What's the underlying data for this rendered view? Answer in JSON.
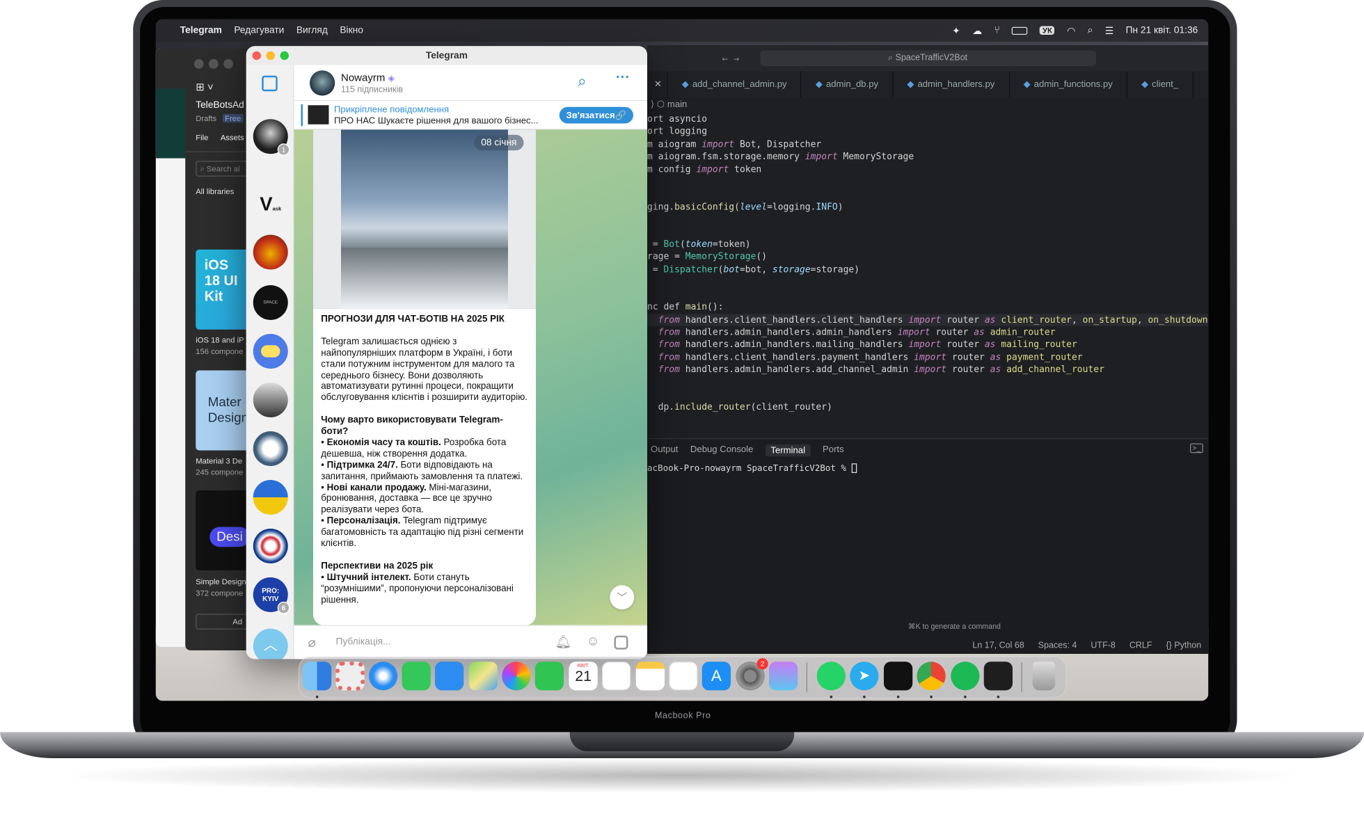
{
  "laptop": {
    "label": "Macbook Pro"
  },
  "menubar": {
    "app": "Telegram",
    "items": [
      "Редагувати",
      "Вигляд",
      "Вікно"
    ],
    "input_source": "УК",
    "datetime": "Пн 21 квіт.  01:36"
  },
  "figma": {
    "project": "TeleBotsAd",
    "drafts": "Drafts",
    "plan": "Free",
    "tabs": [
      "File",
      "Assets"
    ],
    "search_placeholder": "Search al",
    "libraries_label": "All libraries",
    "cards": [
      {
        "art": "iOS 18 UI Kit",
        "title": "iOS 18 and iP",
        "count": "156 compone"
      },
      {
        "art": "Mater Design",
        "title": "Material 3 De",
        "count": "245 compone"
      },
      {
        "art": "Desi",
        "title": "Simple Design",
        "count": "372 compone"
      }
    ],
    "add_button": "Ad"
  },
  "telegram": {
    "window_title": "Telegram",
    "channel_name": "Nowayrm",
    "subscribers": "115 підписників",
    "pinned_label": "Прикріплене повідомлення",
    "pinned_text": "ПРО НАС  Шукаєте рішення для вашого бізнес...",
    "contact_button": "Зв'язатися🔗",
    "photo_date": "08 січня",
    "post_title": "ПРОГНОЗИ ДЛЯ ЧАТ-БОТІВ НА 2025 РІК",
    "post_intro": "Telegram залишається однією з найпопулярніших платформ в Україні, і боти стали потужним інструментом для малого та середнього бізнесу. Вони дозволяють автоматизувати рутинні процеси, покращити обслуговування клієнтів і розширити аудиторію.",
    "why_heading": "Чому варто використовувати Telegram-боти?",
    "why_items": [
      {
        "bold": "Економія часу та коштів.",
        "text": " Розробка бота дешевша, ніж створення додатка."
      },
      {
        "bold": "Підтримка 24/7.",
        "text": " Боти відповідають на запитання, приймають замовлення та платежі."
      },
      {
        "bold": "Нові канали продажу.",
        "text": " Міні-магазини, бронювання, доставка — все це зручно реалізувати через бота."
      },
      {
        "bold": "Персоналізація.",
        "text": " Telegram підтримує багатомовність та адаптацію під різні сегменти клієнтів."
      }
    ],
    "perspectives_heading": "Перспективи на 2025 рік",
    "perspective_items": [
      {
        "bold": "Штучний інтелект.",
        "text": " Боти стануть “розумнішими”, пропонуючи персоналізовані рішення."
      }
    ],
    "input_placeholder": "Публікація...",
    "sidebar_badges": [
      "1",
      "6"
    ],
    "sidebar_v_label": "V",
    "sidebar_v_sub": "ask",
    "sidebar_space": "SPACE",
    "sidebar_prokyiv": "PRO: KYIV"
  },
  "editor": {
    "search": "SpaceTrafficV2Bot",
    "tabs": [
      "add_channel_admin.py",
      "admin_db.py",
      "admin_handlers.py",
      "admin_functions.py",
      "client_"
    ],
    "breadcrumb": "main",
    "panel_tabs": [
      "Output",
      "Debug Console",
      "Terminal",
      "Ports"
    ],
    "terminal_line": "acBook-Pro-nowayrm SpaceTrafficV2Bot % ",
    "generate_hint": "⌘K to generate a command",
    "status": {
      "position": "Ln 17, Col 68",
      "spaces": "Spaces: 4",
      "encoding": "UTF-8",
      "eol": "CRLF",
      "language": "Python"
    }
  },
  "dock": {
    "calendar_month": "КВІТ.",
    "calendar_day": "21",
    "settings_badge": "2"
  },
  "colors": {
    "telegram_blue": "#2f8fd8",
    "menubar": "#28282c",
    "editor_bg": "#1e1f22"
  }
}
